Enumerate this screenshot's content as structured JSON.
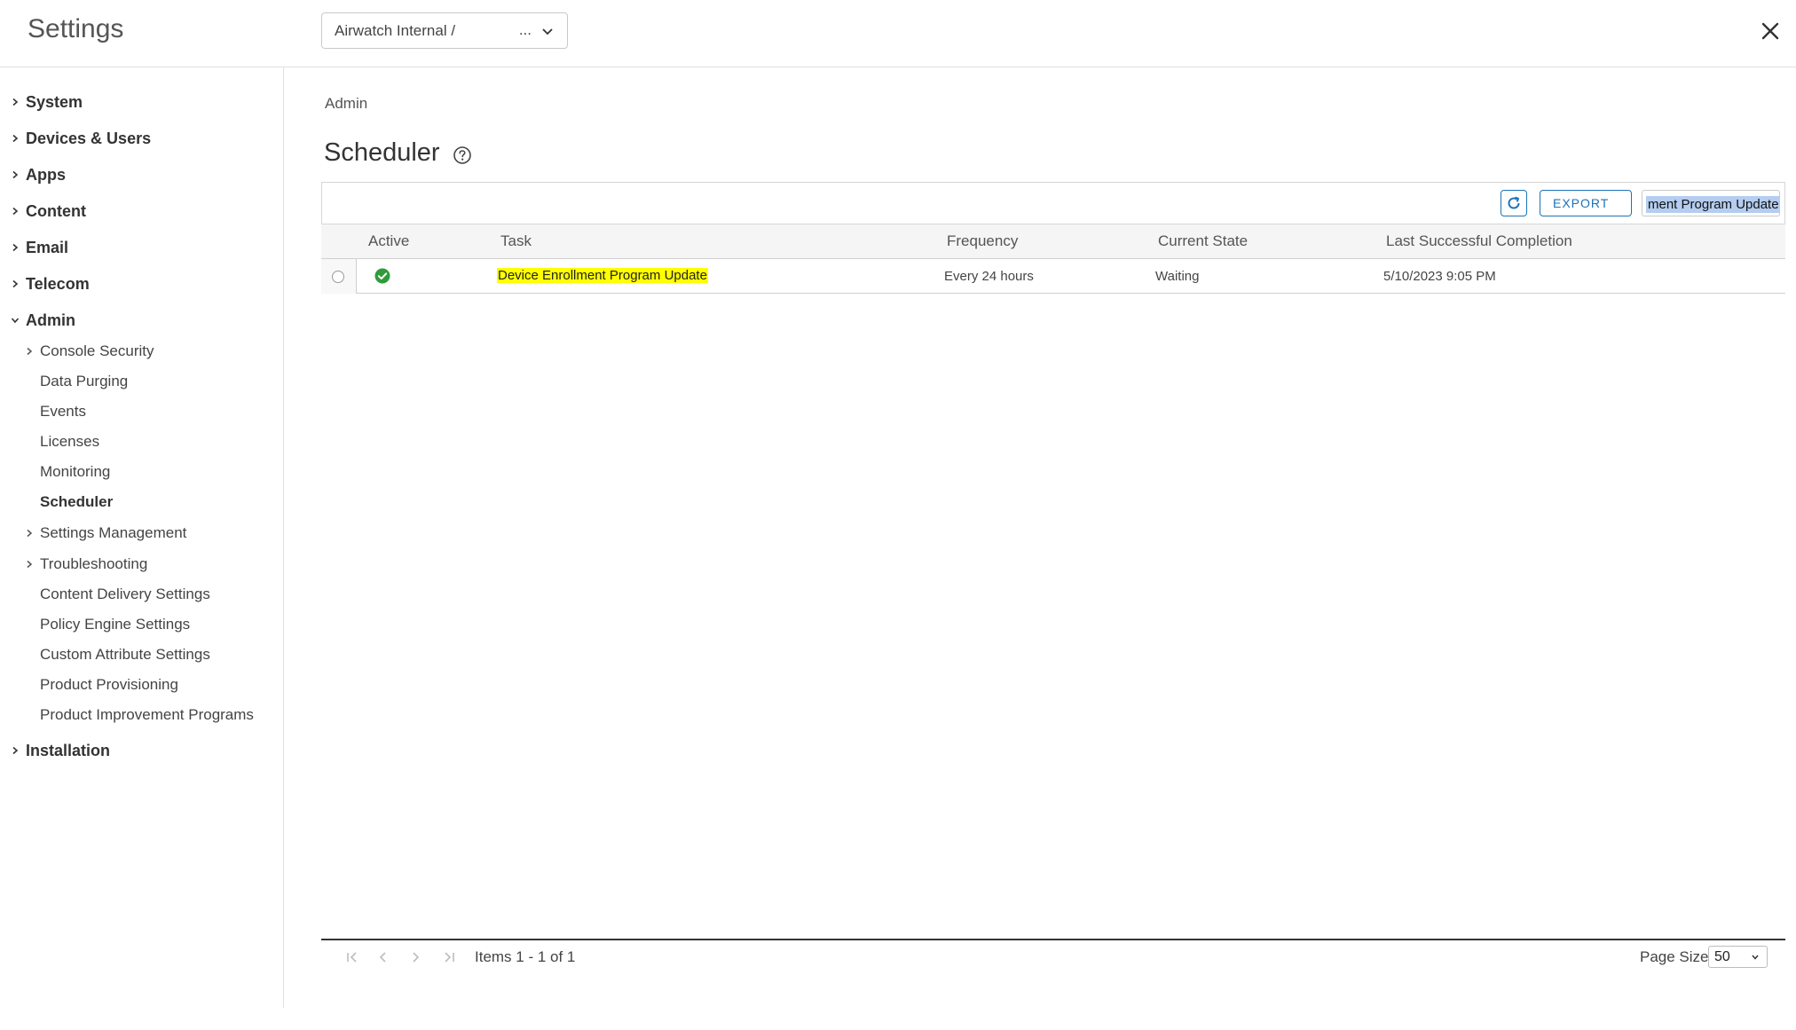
{
  "header": {
    "title": "Settings",
    "org_group": "Airwatch Internal /",
    "org_group_ellipsis": "..."
  },
  "sidebar": {
    "items": [
      {
        "label": "System"
      },
      {
        "label": "Devices & Users"
      },
      {
        "label": "Apps"
      },
      {
        "label": "Content"
      },
      {
        "label": "Email"
      },
      {
        "label": "Telecom"
      },
      {
        "label": "Admin"
      },
      {
        "label": "Installation"
      }
    ],
    "admin_children": [
      {
        "label": "Console Security"
      },
      {
        "label": "Data Purging"
      },
      {
        "label": "Events"
      },
      {
        "label": "Licenses"
      },
      {
        "label": "Monitoring"
      },
      {
        "label": "Scheduler"
      },
      {
        "label": "Settings Management"
      },
      {
        "label": "Troubleshooting"
      },
      {
        "label": "Content Delivery Settings"
      },
      {
        "label": "Policy Engine Settings"
      },
      {
        "label": "Custom Attribute Settings"
      },
      {
        "label": "Product Provisioning"
      },
      {
        "label": "Product Improvement Programs"
      }
    ]
  },
  "main": {
    "breadcrumb": "Admin",
    "title": "Scheduler",
    "toolbar": {
      "export_label": "EXPORT",
      "search_value": "ment Program Update"
    },
    "grid": {
      "columns": [
        "Active",
        "Task",
        "Frequency",
        "Current State",
        "Last Successful Completion"
      ],
      "rows": [
        {
          "task": "Device Enrollment Program Update",
          "frequency": "Every 24 hours",
          "state": "Waiting",
          "last_completion": "5/10/2023 9:05 PM"
        }
      ]
    },
    "pager": {
      "items_text": "Items 1 - 1 of 1",
      "page_size_label": "Page Size:",
      "page_size": "50"
    }
  },
  "colors": {
    "accent": "#1a73b8",
    "active_green": "#2e9c3a",
    "highlight": "#ffff00",
    "selection": "#b4cdf0"
  }
}
